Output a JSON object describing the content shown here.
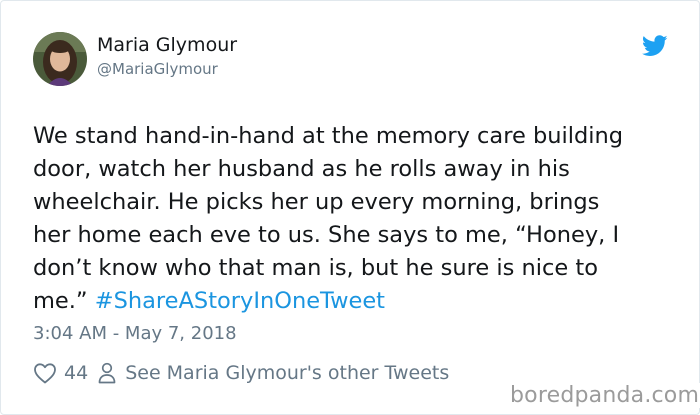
{
  "author": {
    "name": "Maria Glymour",
    "handle": "@MariaGlymour",
    "avatar": "avatar-photo"
  },
  "tweet": {
    "lines": [
      "We stand hand-in-hand at the memory care building",
      "door, watch her husband as he rolls away in his",
      "wheelchair. He picks her up every morning, brings",
      "her home each eve to us. She says to me, “Honey, I",
      "don’t know who that man is, but he sure is nice to"
    ],
    "last_line_prefix": "me.”",
    "hashtag": "#ShareAStoryInOneTweet",
    "timestamp": "3:04 AM - May 7, 2018"
  },
  "footer": {
    "likes": "44",
    "other_tweets_label": "See Maria Glymour's other Tweets",
    "heart_icon": "heart-icon",
    "person_icon": "person-icon"
  },
  "brand": {
    "bird_icon": "twitter-bird-icon",
    "bird_color": "#1da1f2",
    "hashtag_color": "#1b95e0",
    "muted_color": "#657786"
  },
  "watermark": "boredpanda.com"
}
